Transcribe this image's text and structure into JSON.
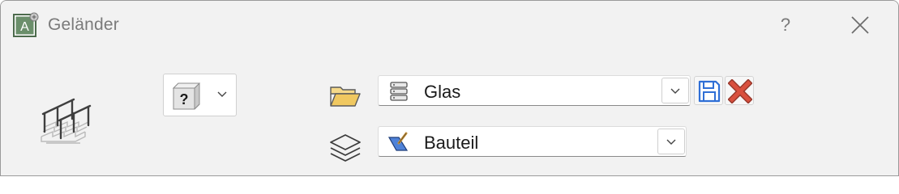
{
  "window": {
    "title": "Geländer",
    "help_label": "?",
    "app_icon_letter": "A"
  },
  "category_selector": {
    "selected_icon": "unknown-cube-icon",
    "glyph": "?"
  },
  "material": {
    "icon": "database-icon",
    "value": "Glas",
    "row_icon": "open-folder-icon"
  },
  "layer": {
    "icon": "component-pen-icon",
    "value": "Bauteil",
    "row_icon": "layers-icon"
  },
  "colors": {
    "accent_blue": "#2f6fd6",
    "delete_red": "#d9503e",
    "folder_yellow": "#f0c860"
  }
}
